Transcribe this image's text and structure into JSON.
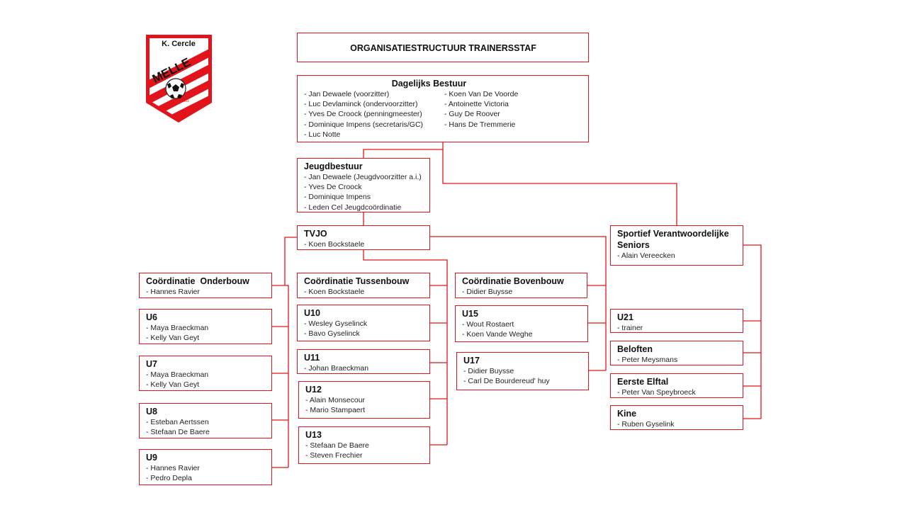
{
  "logo": {
    "club_prefix": "K. Cercle",
    "club_name": "MELLE",
    "year": "1932",
    "colors": {
      "primary": "#e2141b",
      "secondary": "#ffffff"
    }
  },
  "title": "ORGANISATIESTRUCTUUR TRAINERSSTAF",
  "accent_color": "#e2141b",
  "dagelijks_bestuur": {
    "title": "Dagelijks Bestuur",
    "members_col1": [
      "Jan Dewaele (voorzitter)",
      "Luc Devlaminck (ondervoorzitter)",
      "Yves De Croock (penningmeester)",
      "Dominique Impens (secretaris/GC)",
      "Luc Notte"
    ],
    "members_col2": [
      "Koen Van De Voorde",
      "Antoinette Victoria",
      "Guy De Roover",
      "Hans De Tremmerie"
    ]
  },
  "jeugdbestuur": {
    "title": "Jeugdbestuur",
    "members": [
      "Jan Dewaele (Jeugdvoorzitter a.i.)",
      "Yves De Croock",
      "Dominique Impens",
      "Leden Cel Jeugdcoördinatie"
    ]
  },
  "tvjo": {
    "title": "TVJO",
    "members": [
      "Koen Bockstaele"
    ]
  },
  "sportief": {
    "title": "Sportief Verantwoordelijke Seniors",
    "members": [
      "Alain Vereecken"
    ]
  },
  "onderbouw": {
    "coordination": {
      "title": "Coördinatie  Onderbouw",
      "members": [
        "Hannes Ravier"
      ]
    },
    "teams": [
      {
        "title": "U6",
        "members": [
          "Maya Braeckman",
          "Kelly Van Geyt"
        ]
      },
      {
        "title": "U7",
        "members": [
          "Maya Braeckman",
          "Kelly Van Geyt"
        ]
      },
      {
        "title": "U8",
        "members": [
          "Esteban Aertssen",
          "Stefaan De Baere"
        ]
      },
      {
        "title": "U9",
        "members": [
          "Hannes Ravier",
          "Pedro Depla"
        ]
      }
    ]
  },
  "tussenbouw": {
    "coordination": {
      "title": "Coördinatie Tussenbouw",
      "members": [
        "Koen Bockstaele"
      ]
    },
    "teams": [
      {
        "title": "U10",
        "members": [
          "Wesley Gyselinck",
          "Bavo Gyselinck"
        ]
      },
      {
        "title": "U11",
        "members": [
          "Johan Braeckman"
        ]
      },
      {
        "title": "U12",
        "members": [
          "Alain Monsecour",
          "Mario Stampaert"
        ]
      },
      {
        "title": "U13",
        "members": [
          "Stefaan De Baere",
          "Steven Frechier"
        ]
      }
    ]
  },
  "bovenbouw": {
    "coordination": {
      "title": "Coördinatie Bovenbouw",
      "members": [
        "Didier Buysse"
      ]
    },
    "teams": [
      {
        "title": "U15",
        "members": [
          "Wout Rostaert",
          "Koen Vande Weghe"
        ]
      },
      {
        "title": "U17",
        "members": [
          "Didier Buysse",
          "Carl De Bourdereud' huy"
        ]
      }
    ]
  },
  "seniors": {
    "teams": [
      {
        "title": "U21",
        "members": [
          "trainer"
        ]
      },
      {
        "title": "Beloften",
        "members": [
          "Peter Meysmans"
        ]
      },
      {
        "title": "Eerste Elftal",
        "members": [
          "Peter Van Speybroeck"
        ]
      },
      {
        "title": "Kine",
        "members": [
          "Ruben Gyselink"
        ]
      }
    ]
  }
}
